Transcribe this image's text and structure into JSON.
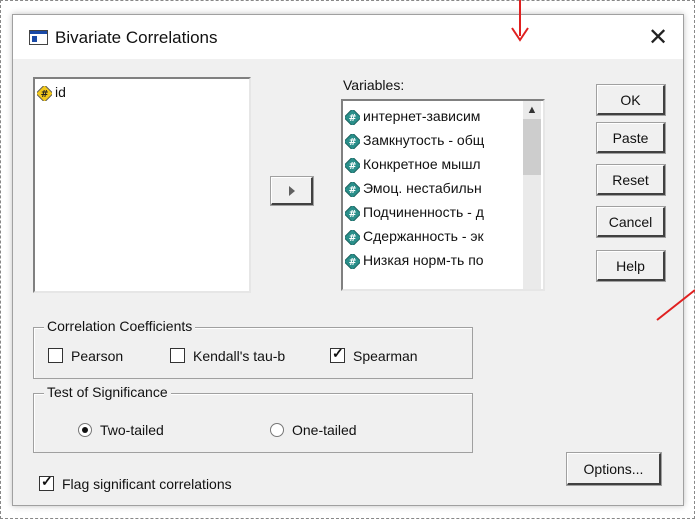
{
  "window": {
    "title": "Bivariate Correlations"
  },
  "source_list": {
    "items": [
      {
        "label": "id"
      }
    ]
  },
  "variables": {
    "label": "Variables:",
    "items": [
      {
        "label": "интернет-зависим"
      },
      {
        "label": "Замкнутость - общ"
      },
      {
        "label": "Конкретное мышл"
      },
      {
        "label": "Эмоц. нестабильн"
      },
      {
        "label": "Подчиненность - д"
      },
      {
        "label": "Сдержанность - эк"
      },
      {
        "label": "Низкая норм-ть по"
      }
    ]
  },
  "buttons": {
    "ok": "OK",
    "paste": "Paste",
    "reset": "Reset",
    "cancel": "Cancel",
    "help": "Help",
    "options": "Options..."
  },
  "correlation": {
    "legend": "Correlation Coefficients",
    "pearson": {
      "label": "Pearson",
      "checked": false
    },
    "kendall": {
      "label": "Kendall's tau-b",
      "checked": false
    },
    "spearman": {
      "label": "Spearman",
      "checked": true
    }
  },
  "significance": {
    "legend": "Test of Significance",
    "two_tailed": {
      "label": "Two-tailed",
      "selected": true
    },
    "one_tailed": {
      "label": "One-tailed",
      "selected": false
    }
  },
  "flag": {
    "label": "Flag significant correlations",
    "checked": true
  },
  "colors": {
    "annotation_red": "#e02020",
    "var_icon_teal": "#2a8f8a",
    "id_icon_yellow": "#f2c81c"
  }
}
